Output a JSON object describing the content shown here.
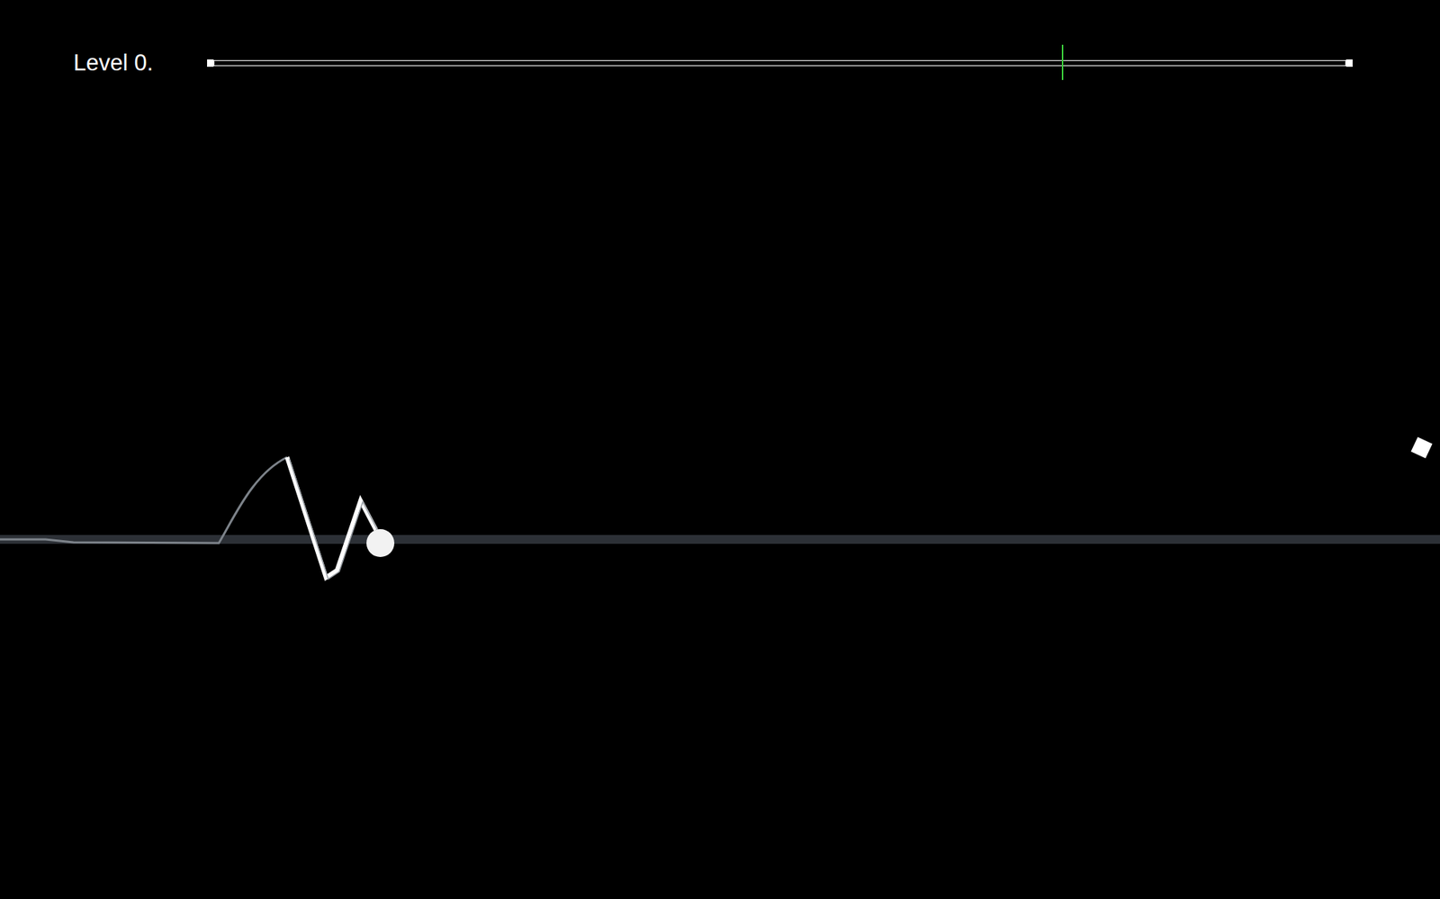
{
  "hud": {
    "title": "Level 0."
  },
  "progress": {
    "level": 0.75
  }
}
